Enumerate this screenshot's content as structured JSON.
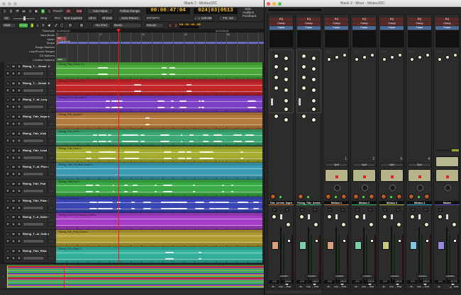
{
  "editor": {
    "title": "Blank 2 - Mixbus32C",
    "toolbar": {
      "punch_label": "Punch:",
      "punch_in": "In",
      "punch_out": "Out",
      "auto_input": "Auto-Input",
      "follow_range": "Follow Range",
      "int_label": "Int.",
      "stop": "Stop",
      "rec_label": "Rec:",
      "rec_mode": "Non-Layered",
      "all_in": "All In",
      "all_disk": "All Disk",
      "auto_return": "Auto Return",
      "primary_clock": "00:00:47:04",
      "secondary_clock": "024|03|0513",
      "sync": "INT/MTC",
      "tempo": "♩ = 120.000",
      "meter": "TS: 4/4",
      "solo": "Solo",
      "audition": "Audition",
      "feedback": "Feedback"
    },
    "edit_toolbar": {
      "edit_mode": "Slide",
      "smart": "Smart",
      "grid": "No Grid",
      "grid_type": "Beats",
      "edit_point": "Mouse",
      "nudge_clock": "00:00:05:00"
    },
    "rulers": {
      "names": [
        "Timecode",
        "Bars:Beats",
        "Meter",
        "Tempo",
        "Range Markers",
        "Loop/Punch Ranges",
        "CD Markers",
        "Location Markers"
      ],
      "timecode_ticks": [
        "00:00:00:00",
        "00:02:00:00"
      ],
      "bar_ticks": [
        "1",
        "17",
        "33",
        "49",
        "65"
      ],
      "meter_marker": "4/4",
      "tempo_marker": "120.000/4",
      "location_marker": "start"
    },
    "track_buttons": {
      "rec": "●",
      "mute": "M",
      "solo": "S",
      "playlist": "P",
      "automation": "A",
      "group": "G"
    },
    "tracks": [
      {
        "name": "Rising_T..._Growl_4",
        "region": "Rising_Tide_Growl_4.1",
        "color": "#4aa83a"
      },
      {
        "name": "Rising_T..._Growl_5",
        "region": "Rising_Tide_Growl_5.1",
        "color": "#c0262a"
      },
      {
        "name": "Rising_T...at_Loop",
        "region": "Rising_Tide_Hat_Loop.1",
        "color": "#7b3ec4"
      },
      {
        "name": "Rising_Tide_Impact",
        "region": "Rising_Tide_Impact.1",
        "color": "#b47a3c"
      },
      {
        "name": "Rising_Tide_Kick",
        "region": "Rising_Tide_Kick.1",
        "color": "#3aa872"
      },
      {
        "name": "Rising_Tide_Lead",
        "region": "Rising_Tide_Lead.1",
        "color": "#a4ac2e"
      },
      {
        "name": "Rising_T...at_Piano",
        "region": "Rising_Tide_Off_Beat_Piano.1",
        "color": "#3a9cb4"
      },
      {
        "name": "Rising_Tide_Pad",
        "region": "Rising_Tide_Pad.1",
        "color": "#3aaa46"
      },
      {
        "name": "Rising_Tide_Piano",
        "region": "Rising_Tide_Piano.1",
        "color": "#3a46b4"
      },
      {
        "name": "Rising_T...d_Guitar",
        "region": "Rising_Tide_Pre-Fucked_Guitar.1",
        "color": "#a63cc4"
      },
      {
        "name": "Rising_T...al_Guitar",
        "region": "Rising_Tide_Real_Guitar.1",
        "color": "#b09a32"
      },
      {
        "name": "Rising_Tide_Riser",
        "region": "Rising_Tide_Riser.1",
        "color": "#32b09c"
      }
    ]
  },
  "mixer": {
    "title": "Blank 2 - Mixer - Mixbus32C",
    "processors": [
      "EQ",
      "Comp",
      "Fader"
    ],
    "knob_labels": {
      "attn": "ATTN",
      "leveler": "Leveler"
    },
    "strips": [
      {
        "name": "Tide_Arrival_Super",
        "color": "#d8782e",
        "type": "track",
        "gain": "-0.0",
        "peak": "-150.5",
        "buttons": [
          "M",
          "Grp",
          "Post"
        ],
        "fader_color": "#d9a07a"
      },
      {
        "name": "Rising_Tide_Ambie",
        "color": "#3ac07a",
        "type": "track",
        "gain": "-0.0",
        "peak": "-150.5",
        "buttons": [
          "M",
          "Grp",
          "Post"
        ],
        "fader_color": "#7ad0a8"
      },
      {
        "name": "Mixbus 1",
        "color": "#d8782e",
        "type": "bus",
        "number": "1",
        "split": "Split",
        "gain": "-0.0",
        "peak": "-150.5",
        "buttons": [
          "M",
          "Grp",
          "Post"
        ],
        "fader_color": "#d9a07a"
      },
      {
        "name": "Mixbus 2",
        "color": "#3ac07a",
        "type": "bus",
        "number": "2",
        "split": "Split",
        "gain": "-0.0",
        "peak": "-150.5",
        "buttons": [
          "M",
          "Grp",
          "Post"
        ],
        "fader_color": "#7ad0a8"
      },
      {
        "name": "Mixbus 3",
        "color": "#b4c030",
        "type": "bus",
        "number": "3",
        "split": "Split",
        "gain": "-0.0",
        "peak": "-150.5",
        "buttons": [
          "M",
          "Grp",
          "Post"
        ],
        "fader_color": "#c8cc80"
      },
      {
        "name": "Mixbus 4",
        "color": "#30a8d0",
        "type": "bus",
        "number": "4",
        "split": "Split",
        "gain": "-0.0",
        "peak": "-150.5",
        "buttons": [
          "M",
          "Grp",
          "Post"
        ],
        "fader_color": "#80c8e0"
      },
      {
        "name": "Master",
        "color": "#6a48d0",
        "type": "master",
        "gain": "-0.0",
        "peak": "-117.5",
        "buttons": [
          "M",
          "Post"
        ],
        "fader_color": "#9a88e0"
      }
    ]
  },
  "colors": {
    "playhead": "#e02020",
    "clock_text": "#f5b820",
    "smart_active": "#2fa82f"
  }
}
